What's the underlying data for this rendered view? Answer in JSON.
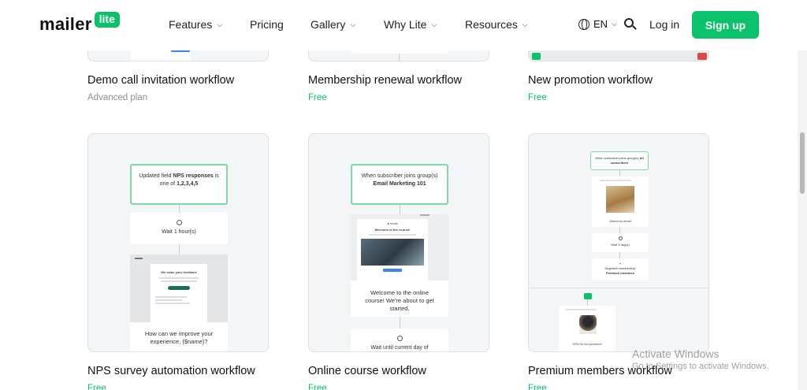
{
  "nav": {
    "logo_word": "mailer",
    "logo_badge": "lite",
    "items": [
      {
        "label": "Features",
        "has_menu": true
      },
      {
        "label": "Pricing",
        "has_menu": false
      },
      {
        "label": "Gallery",
        "has_menu": true
      },
      {
        "label": "Why Lite",
        "has_menu": true
      },
      {
        "label": "Resources",
        "has_menu": true
      }
    ],
    "language": "EN",
    "login": "Log in",
    "signup": "Sign up"
  },
  "top_row": [
    {
      "title": "Demo call invitation workflow",
      "plan": "Advanced plan"
    },
    {
      "title": "Membership renewal workflow",
      "plan": "Free"
    },
    {
      "title": "New promotion workflow",
      "plan": "Free"
    }
  ],
  "cards": [
    {
      "title": "NPS survey automation workflow",
      "plan": "Free",
      "trigger": {
        "prefix": "Updated field ",
        "bold": "NPS responses",
        "suffix": " is one of ",
        "bold2": "1,2,3,4,5"
      },
      "wait": "Wait 1 hour(s)",
      "email_heading": "We value your feedback",
      "email_subject": "How can we improve your experience, {$name}?"
    },
    {
      "title": "Online course workflow",
      "plan": "Free",
      "trigger": {
        "prefix": "When subscriber joins group(s) ",
        "bold": "Email Marketing 101"
      },
      "email_heading": "Welcome to the course!",
      "email_subject": "Welcome to the online course! We're about to get started.",
      "wait": "Wait until current day of"
    },
    {
      "title": "Premium members workflow",
      "plan": "Free",
      "trigger": {
        "prefix": "When subscriber joins group(s) ",
        "bold": "All subscribers"
      },
      "email1": "Welcome email",
      "wait": "Wait 3 day(s)",
      "segment": "Segment membership",
      "segment_value": "Premium members",
      "email2_caption": "20% for our premium"
    }
  ],
  "watermark": {
    "line1": "Activate Windows",
    "line2": "Go to Settings to activate Windows."
  },
  "colors": {
    "brand": "#09c269",
    "advanced_plan": "#8a8f96",
    "card_bg": "#f4f5f6"
  }
}
